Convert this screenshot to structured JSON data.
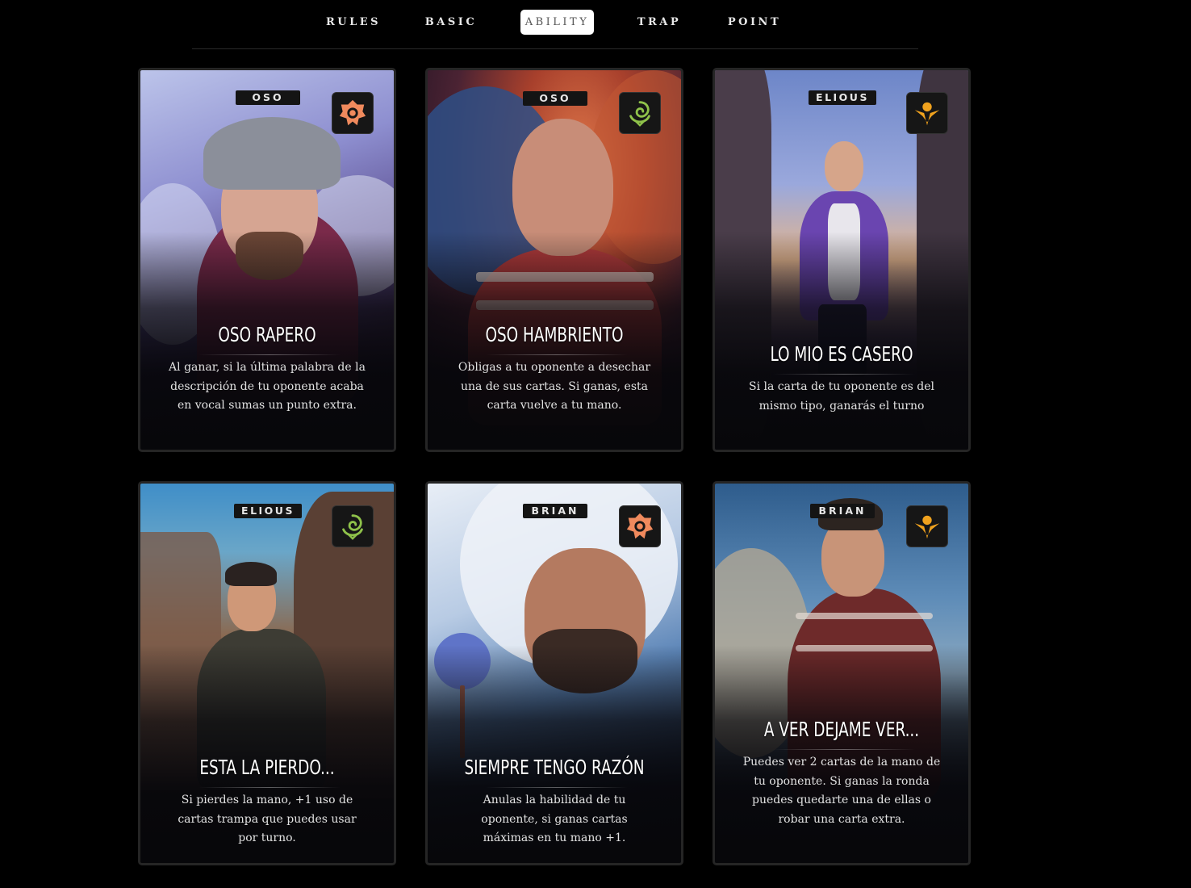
{
  "nav": {
    "items": [
      "RULES",
      "BASIC",
      "ABILITY",
      "TRAP",
      "POINT"
    ],
    "active": "ABILITY"
  },
  "cards": [
    {
      "tag": "OSO",
      "icon": "rose-shield-icon",
      "icon_color": "#f08a5d",
      "title": "OSO RAPERO",
      "description": "Al ganar, si la última palabra de la descripción de tu oponente acaba en vocal sumas un punto extra."
    },
    {
      "tag": "OSO",
      "icon": "spiral-leaf-icon",
      "icon_color": "#8fc24a",
      "title": "OSO HAMBRIENTO",
      "description": "Obligas a tu oponente a desechar una de sus cartas. Si ganas, esta carta vuelve a tu mano."
    },
    {
      "tag": "ELIOUS",
      "icon": "sun-wings-icon",
      "icon_color": "#f0a21e",
      "title": "LO MIO ES CASERO",
      "description": "Si la carta de tu oponente es del mismo tipo, ganarás el turno"
    },
    {
      "tag": "ELIOUS",
      "icon": "spiral-leaf-icon",
      "icon_color": "#8fc24a",
      "title": "ESTA LA PIERDO...",
      "description": "Si pierdes la mano, +1 uso de cartas trampa que puedes usar por turno."
    },
    {
      "tag": "BRIAN",
      "icon": "rose-shield-icon",
      "icon_color": "#f08a5d",
      "title": "SIEMPRE TENGO RAZÓN",
      "description": "Anulas la habilidad de tu oponente, si ganas cartas máximas en tu mano +1."
    },
    {
      "tag": "BRIAN",
      "icon": "sun-wings-icon",
      "icon_color": "#f0a21e",
      "title": "A VER DEJAME VER...",
      "description": "Puedes ver 2 cartas de la mano de tu oponente. Si ganas la ronda puedes quedarte una de ellas o robar una carta extra."
    }
  ]
}
